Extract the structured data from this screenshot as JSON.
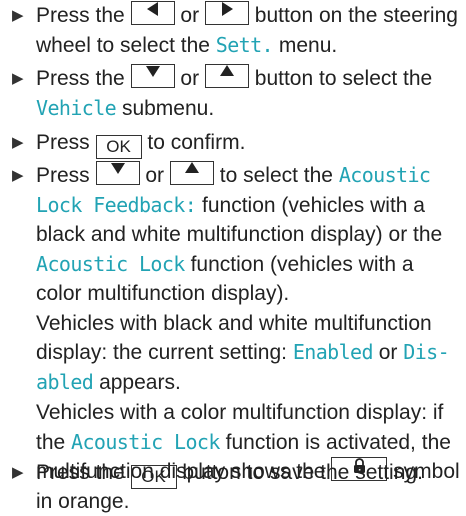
{
  "bullet_glyph": "▶",
  "accent_color": "#22a3b4",
  "keys": {
    "left": "left-arrow-icon",
    "right": "right-arrow-icon",
    "down": "down-arrow-icon",
    "up": "up-arrow-icon",
    "ok": "OK",
    "lock": "padlock-icon"
  },
  "step1": {
    "a": "Press the",
    "b": "or",
    "c": "button on the steering",
    "d": "wheel to select the",
    "menu": "Sett.",
    "e": "menu."
  },
  "step2": {
    "a": "Press the",
    "b": "or",
    "c": "button to select the",
    "submenu": "Vehicle",
    "d": "submenu."
  },
  "step3": {
    "a": "Press",
    "b": "to confirm."
  },
  "step4": {
    "a": "Press",
    "b": "or",
    "c": "to select the",
    "fn1_l1": "Acoustic",
    "fn1_l2": "Lock Feedback:",
    "d": "function (vehicles with a",
    "e": "black and white multifunction display) or the",
    "fn2": "Acoustic Lock",
    "f": "function (vehicles with a",
    "g": "color multifunction display).",
    "h": "Vehicles with black and white multifunction",
    "i": "display: the current setting:",
    "opt1": "Enabled",
    "or": "or",
    "opt2_l1": "Dis-",
    "opt2_l2": "abled",
    "j": "appears."
  },
  "note": {
    "a": "Vehicles with a color multifunction display: if",
    "b": "the",
    "fn": "Acoustic Lock",
    "c": "function is activated, the",
    "d": "multifunction display shows the",
    "e": "symbol",
    "f": "in orange."
  },
  "step5": {
    "a": "Press the",
    "b": "button to save the setting."
  }
}
